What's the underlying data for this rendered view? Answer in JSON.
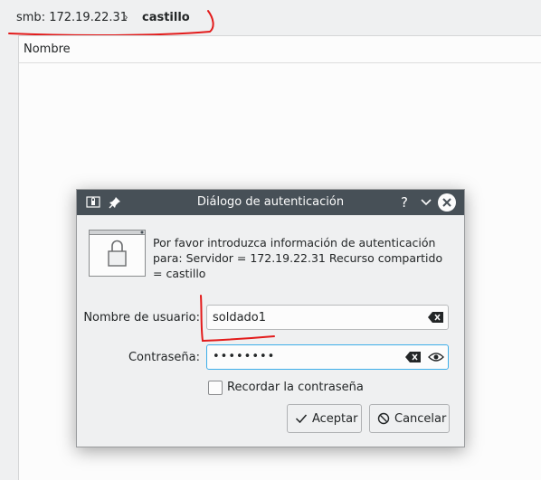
{
  "breadcrumb": {
    "segments": [
      "smb: 172.19.22.31",
      "castillo"
    ],
    "separator": "›"
  },
  "file_view": {
    "column_header": "Nombre"
  },
  "dialog": {
    "title": "Diálogo de autenticación",
    "titlebar_buttons": [
      "help-icon",
      "minimize-icon",
      "close-icon"
    ],
    "message": "Por favor introduzca información de autenticación para: Servidor = 172.19.22.31 Recurso compartido = castillo",
    "username_label": "Nombre de usuario:",
    "username_value": "soldado1",
    "password_label": "Contraseña:",
    "password_value": "••••••••",
    "remember_label": "Recordar la contraseña",
    "remember_checked": false,
    "ok_label": "Aceptar",
    "cancel_label": "Cancelar"
  },
  "colors": {
    "titlebar": "#475057",
    "focus": "#3daee9",
    "annotation": "#e31b1b"
  }
}
